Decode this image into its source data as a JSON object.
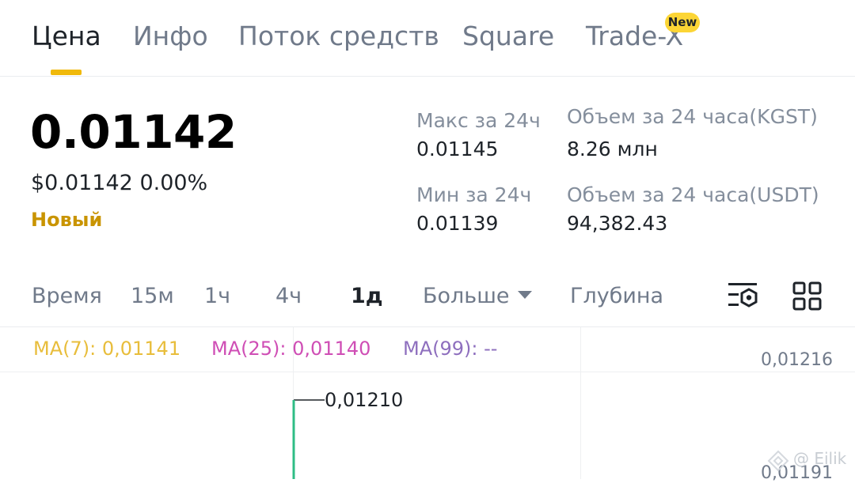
{
  "tabs": [
    {
      "label": "Цена",
      "active": true
    },
    {
      "label": "Инфо",
      "active": false
    },
    {
      "label": "Поток средств",
      "active": false
    },
    {
      "label": "Square",
      "active": false
    },
    {
      "label": "Trade-X",
      "active": false,
      "badge": "New"
    }
  ],
  "price": {
    "main": "0.01142",
    "usd": "$0.01142",
    "change": "0.00%",
    "tag": "Новый"
  },
  "stats": {
    "high_label": "Макс за 24ч",
    "high_value": "0.01145",
    "low_label": "Мин за 24ч",
    "low_value": "0.01139",
    "vol_base_label": "Объем за 24 часа(KGST)",
    "vol_base_value": "8.26 млн",
    "vol_quote_label": "Объем за 24 часа(USDT)",
    "vol_quote_value": "94,382.43"
  },
  "intervals": {
    "time": "Время",
    "m15": "15м",
    "h1": "1ч",
    "h4": "4ч",
    "d1": "1д",
    "more": "Больше",
    "depth": "Глубина",
    "selected": "1д"
  },
  "ma": {
    "ma7": "MA(7): 0,01141",
    "ma25": "MA(25): 0,01140",
    "ma99": "MA(99): --"
  },
  "chart": {
    "axis_labels": [
      "0,01216",
      "0,01191"
    ],
    "high_marker": "0,01210",
    "watermark": "@ Eilik"
  },
  "colors": {
    "accent": "#f0b90b",
    "up": "#2ebd85",
    "new_tag": "#c99400",
    "ma7": "#e8bd3b",
    "ma25": "#cf4eb5",
    "ma99": "#8e6fbe"
  },
  "icons": {
    "chart_settings": "chart-settings-icon",
    "layout_grid": "grid-layout-icon",
    "dropdown": "caret-down-icon",
    "watermark_logo": "binance-logo-icon"
  }
}
